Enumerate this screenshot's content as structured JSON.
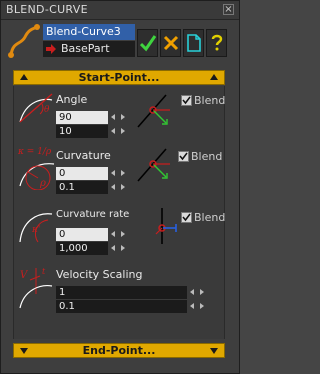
{
  "window": {
    "title": "BLEND-CURVE",
    "close_glyph": "×"
  },
  "header": {
    "curve_name": "Blend-Curve3",
    "base_part": "BasePart",
    "buttons": [
      {
        "name": "ok",
        "icon": "checkmark-icon",
        "color": "#3fd43f"
      },
      {
        "name": "cancel",
        "icon": "cross-icon",
        "color": "#f0a000"
      },
      {
        "name": "new",
        "icon": "new-document-icon",
        "color": "#28d0d8"
      },
      {
        "name": "help",
        "icon": "question-icon",
        "color": "#e0d000"
      }
    ]
  },
  "start_bar": {
    "label": "Start-Point..."
  },
  "end_bar": {
    "label": "End-Point..."
  },
  "sections": {
    "angle": {
      "label": "Angle",
      "value": "90",
      "step": "10",
      "blend_label": "Blend",
      "blend_checked": true
    },
    "curvature": {
      "label": "Curvature",
      "value": "0",
      "step": "0.1",
      "blend_label": "Blend",
      "blend_checked": true,
      "formula": "κ = 1/ρ",
      "rho": "ρ"
    },
    "curvature_rate": {
      "label": "Curvature rate",
      "value": "0",
      "step": "1,000",
      "blend_label": "Blend",
      "blend_checked": true,
      "kappa": "κ'"
    },
    "velocity": {
      "label": "Velocity Scaling",
      "value": "1",
      "step": "0.1",
      "v": "V",
      "t": "t"
    }
  },
  "colors": {
    "accent_bar": "#e0a800",
    "selection": "#3160a8",
    "curve_red": "#c81e1e"
  }
}
